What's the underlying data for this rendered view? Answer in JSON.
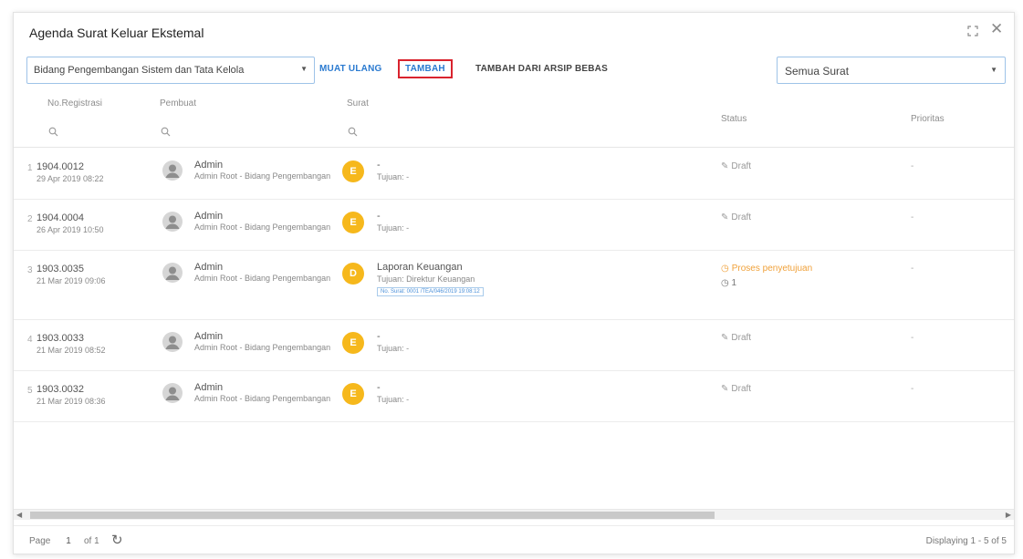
{
  "window": {
    "title": "Agenda Surat Keluar Ekstemal"
  },
  "toolbar": {
    "department": "Bidang Pengembangan Sistem dan Tata Kelola",
    "reload": "MUAT ULANG",
    "add": "TAMBAH",
    "add_from_archive": "TAMBAH DARI ARSIP BEBAS",
    "filter": "Semua Surat"
  },
  "columns": {
    "reg": "No.Registrasi",
    "creator": "Pembuat",
    "letter": "Surat",
    "status": "Status",
    "priority": "Prioritas"
  },
  "rows": [
    {
      "num": "1",
      "reg": "1904.0012",
      "date": "29 Apr 2019 08:22",
      "creator": "Admin",
      "unit": "Admin Root - Bidang Pengembangan",
      "badge": "E",
      "subject": "-",
      "dest": "Tujuan: -",
      "status": "Draft",
      "priority": "-"
    },
    {
      "num": "2",
      "reg": "1904.0004",
      "date": "26 Apr 2019 10:50",
      "creator": "Admin",
      "unit": "Admin Root - Bidang Pengembangan",
      "badge": "E",
      "subject": "-",
      "dest": "Tujuan: -",
      "status": "Draft",
      "priority": "-"
    },
    {
      "num": "3",
      "reg": "1903.0035",
      "date": "21 Mar 2019 09:06",
      "creator": "Admin",
      "unit": "Admin Root - Bidang Pengembangan",
      "badge": "D",
      "subject": "Laporan Keuangan",
      "dest": "Tujuan: Direktur Keuangan",
      "ref": "No. Surat: 0001 /TEA/046/2019 19:08:12",
      "status": "Proses penyetujuan",
      "status_sub": "1",
      "priority": "-"
    },
    {
      "num": "4",
      "reg": "1903.0033",
      "date": "21 Mar 2019 08:52",
      "creator": "Admin",
      "unit": "Admin Root - Bidang Pengembangan",
      "badge": "E",
      "subject": "-",
      "dest": "Tujuan: -",
      "status": "Draft",
      "priority": "-"
    },
    {
      "num": "5",
      "reg": "1903.0032",
      "date": "21 Mar 2019 08:36",
      "creator": "Admin",
      "unit": "Admin Root - Bidang Pengembangan",
      "badge": "E",
      "subject": "-",
      "dest": "Tujuan: -",
      "status": "Draft",
      "priority": "-"
    }
  ],
  "pager": {
    "page_label": "Page",
    "page": "1",
    "of": "of 1",
    "display": "Displaying 1 - 5 of 5"
  },
  "colors": {
    "accent": "#2a7ad0",
    "highlight_border": "#d9232e",
    "badge": "#f6b81c",
    "status_process": "#f0a13a"
  }
}
